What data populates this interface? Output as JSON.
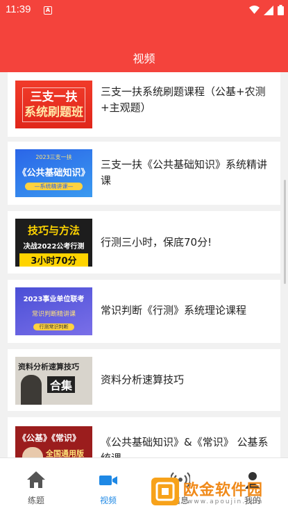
{
  "status_bar": {
    "time": "11:39",
    "notif_icon_label": "A"
  },
  "header": {
    "title": "视频"
  },
  "videos": [
    {
      "title": "三支一扶系统刷题课程（公基+农测+主观题）",
      "thumb": {
        "line1": "三支一扶",
        "line2": "系统刷题班"
      }
    },
    {
      "title": "三支一扶《公共基础知识》系统精讲课",
      "thumb": {
        "line1": "2023三支一扶",
        "line2": "《公共基础知识》",
        "line3": "—系统精讲课—"
      }
    },
    {
      "title": "行测三小时，保底70分!",
      "thumb": {
        "line1": "技巧与方法",
        "line2": "决战2022公考行测",
        "line3": "3小时70分"
      }
    },
    {
      "title": "常识判断《行测》系统理论课程",
      "thumb": {
        "line1": "2023事业单位联考",
        "line2": "常识判断精讲课",
        "line3": "行测常识判断"
      }
    },
    {
      "title": "资料分析速算技巧",
      "thumb": {
        "line1": "资料分析速算技巧",
        "line2": "合集"
      }
    },
    {
      "title": "《公共基础知识》&《常识》 公基系统课",
      "thumb": {
        "line1": "《公基》《常识》",
        "line2": "全国通用版"
      }
    }
  ],
  "tabs": [
    {
      "label": "练题",
      "icon": "home-icon"
    },
    {
      "label": "视频",
      "icon": "video-camera-icon"
    },
    {
      "label": "信息",
      "icon": "broadcast-icon"
    },
    {
      "label": "我的",
      "icon": "person-icon"
    }
  ],
  "watermark": {
    "text": "欧金软件园",
    "url": "www.apoujin.com"
  },
  "colors": {
    "header": "#f4433c",
    "active_tab": "#1e88e5",
    "inactive_tab": "#555555"
  }
}
